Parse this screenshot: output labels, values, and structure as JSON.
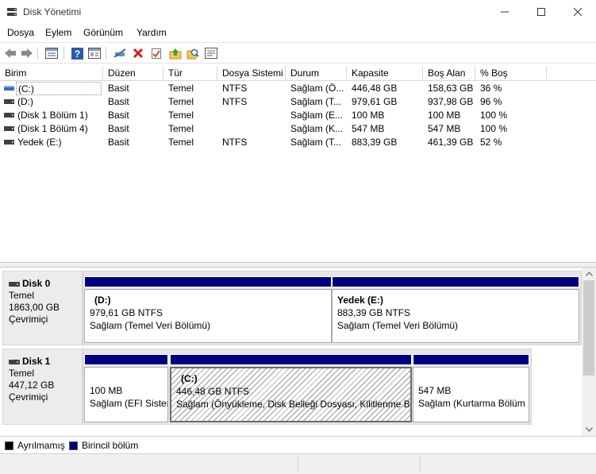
{
  "window": {
    "title": "Disk Yönetimi"
  },
  "menu": [
    "Dosya",
    "Eylem",
    "Görünüm",
    "Yardım"
  ],
  "toolbar_icons": [
    "back-arrow-icon",
    "forward-arrow-icon",
    "list-view-icon",
    "help-icon",
    "properties-icon",
    "connect-icon",
    "delete-icon",
    "check-icon",
    "up-folder-icon",
    "search-icon",
    "console-icon"
  ],
  "columns": [
    "Birim",
    "Düzen",
    "Tür",
    "Dosya Sistemi",
    "Durum",
    "Kapasite",
    "Boş Alan",
    "% Boş"
  ],
  "volumes": [
    {
      "name": "(C:)",
      "layout": "Basit",
      "type": "Temel",
      "fs": "NTFS",
      "status": "Sağlam (Ö...",
      "capacity": "446,48 GB",
      "free": "158,63 GB",
      "pct": "36 %"
    },
    {
      "name": "(D:)",
      "layout": "Basit",
      "type": "Temel",
      "fs": "NTFS",
      "status": "Sağlam (T...",
      "capacity": "979,61 GB",
      "free": "937,98 GB",
      "pct": "96 %"
    },
    {
      "name": "(Disk 1 Bölüm 1)",
      "layout": "Basit",
      "type": "Temel",
      "fs": "",
      "status": "Sağlam (E...",
      "capacity": "100 MB",
      "free": "100 MB",
      "pct": "100 %"
    },
    {
      "name": "(Disk 1 Bölüm 4)",
      "layout": "Basit",
      "type": "Temel",
      "fs": "",
      "status": "Sağlam (K...",
      "capacity": "547 MB",
      "free": "547 MB",
      "pct": "100 %"
    },
    {
      "name": "Yedek (E:)",
      "layout": "Basit",
      "type": "Temel",
      "fs": "NTFS",
      "status": "Sağlam (T...",
      "capacity": "883,39 GB",
      "free": "461,39 GB",
      "pct": "52 %"
    }
  ],
  "disks": [
    {
      "name": "Disk 0",
      "type": "Temel",
      "size": "1863,00 GB",
      "state": "Çevrimiçi",
      "partitions": [
        {
          "name": "(D:)",
          "size": "979,61 GB NTFS",
          "status": "Sağlam (Temel Veri Bölümü)"
        },
        {
          "name": "Yedek  (E:)",
          "size": "883,39 GB NTFS",
          "status": "Sağlam (Temel Veri Bölümü)"
        }
      ]
    },
    {
      "name": "Disk 1",
      "type": "Temel",
      "size": "447,12 GB",
      "state": "Çevrimiçi",
      "partitions": [
        {
          "name": "",
          "size": "100 MB",
          "status": "Sağlam (EFI Sister"
        },
        {
          "name": "(C:)",
          "size": "446,48 GB NTFS",
          "status": "Sağlam (Önyükleme, Disk Belleği Dosyası, Kilitlenme Bil"
        },
        {
          "name": "",
          "size": "547 MB",
          "status": "Sağlam (Kurtarma Bölüm"
        }
      ]
    }
  ],
  "legend": [
    {
      "label": "Ayrılmamış",
      "color": "#000000"
    },
    {
      "label": "Birincil bölüm",
      "color": "#000080"
    }
  ]
}
